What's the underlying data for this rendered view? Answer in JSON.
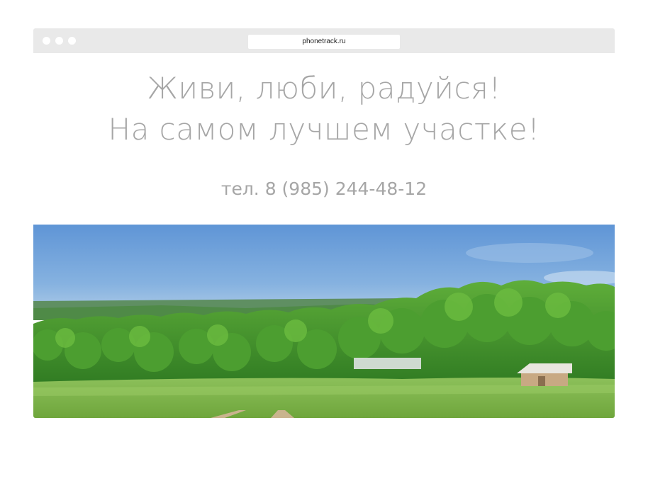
{
  "browser": {
    "url": "phonetrack.ru"
  },
  "hero": {
    "headline_line1": "Живи, люби, радуйся!",
    "headline_line2": "На самом лучшем участке!",
    "phone": "тел. 8 (985) 244-48-12",
    "image_icon": "landscape-photo-icon"
  },
  "colors": {
    "chrome": "#e9e9e9",
    "text_gray": "#a6a6a6",
    "sky": "#6f9fd8",
    "forest": "#3f8f2a",
    "meadow": "#7fb24a"
  }
}
